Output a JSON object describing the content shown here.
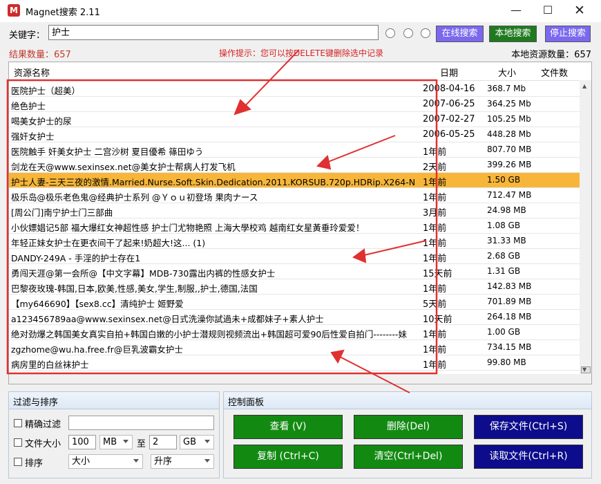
{
  "window": {
    "title": "Magnet搜索 2.11",
    "app_icon_glyph": "M",
    "minimize": "—",
    "maximize": "☐",
    "close": "✕"
  },
  "search": {
    "label": "关键字：",
    "value": "护士",
    "online_button": "在线搜索",
    "local_button": "本地搜索",
    "stop_button": "停止搜索"
  },
  "status": {
    "result_count": "结果数量：657",
    "hint": "操作提示：您可以按DELETE键删除选中记录",
    "local_count": "本地资源数量：657"
  },
  "table": {
    "headers": {
      "name": "资源名称",
      "date": "日期",
      "size": "大小",
      "count": "文件数"
    },
    "rows": [
      {
        "name": "医院护士（超美）",
        "date": "2008-04-16",
        "size": "368.7 Mb"
      },
      {
        "name": "绝色护士",
        "date": "2007-06-25",
        "size": "364.25 Mb"
      },
      {
        "name": "喝美女护士的尿",
        "date": "2007-02-27",
        "size": "105.25 Mb"
      },
      {
        "name": "强奸女护士",
        "date": "2006-05-25",
        "size": "448.28 Mb"
      },
      {
        "name": "医院触手 奸美女护士 二宫沙树 夏目優希 篠田ゆう",
        "date": "1年前",
        "size": "807.70 MB"
      },
      {
        "name": "剑龙在天@www.sexinsex.net@美女护士帮病人打发飞机",
        "date": "2天前",
        "size": "399.26 MB"
      },
      {
        "name": "护士人妻-三天三夜的激情.Married.Nurse.Soft.Skin.Dedication.2011.KORSUB.720p.HDRip.X264-N",
        "date": "1年前",
        "size": "1.50 GB"
      },
      {
        "name": "极乐岛@极乐老色鬼@经典护士系列 @Ｙｏｕ初登场 果肉ナース",
        "date": "1年前",
        "size": "712.47 MB"
      },
      {
        "name": "[周公门]南宁护士门三部曲",
        "date": "3月前",
        "size": "24.98 MB"
      },
      {
        "name": "小伙嫖娼记5部 福大爆红女神超性感 护士门尤物艳照 上海大學校鸡 越南红女星黃垂玲爱爱！",
        "date": "1年前",
        "size": "1.08 GB"
      },
      {
        "name": "年轻正妹女护士在更衣间干了起来!奶超大!这... (1)",
        "date": "1年前",
        "size": "31.33 MB"
      },
      {
        "name": "DANDY-249A - 手淫的护士存在1",
        "date": "1年前",
        "size": "2.68 GB"
      },
      {
        "name": "勇闯天涯@第一会所@【中文字幕】MDB-730露出内裤的性感女护士",
        "date": "15天前",
        "size": "1.31 GB"
      },
      {
        "name": "巴黎夜玫瑰-韩国,日本,欧美,性感,美女,学生,制服,,护士,德国,法国",
        "date": "1年前",
        "size": "142.83 MB"
      },
      {
        "name": "【my646690】【sex8.cc】清纯护士 姬野爱",
        "date": "5天前",
        "size": "701.89 MB"
      },
      {
        "name": "a123456789aa@www.sexinsex.net@日式洗澡你試過未+成都妹子+素人护士",
        "date": "10天前",
        "size": "264.18 MB"
      },
      {
        "name": "绝对劲爆之韩国美女真实自拍+韩国白嫩的小护士潜规则视频流出+韩国超可爱90后性爱自拍门--------妹",
        "date": "1年前",
        "size": "1.00 GB"
      },
      {
        "name": "zgzhome@wu.ha.free.fr@巨乳波霸女护士",
        "date": "1年前",
        "size": "734.15 MB"
      },
      {
        "name": "病房里的白丝袜护士",
        "date": "1年前",
        "size": "99.80 MB"
      }
    ],
    "selected_index": 6,
    "selected_color": "#f7b63a"
  },
  "filter": {
    "title": "过滤与排序",
    "exact_label": "精确过滤",
    "exact_value": "",
    "size_label": "文件大小",
    "size_min": "100",
    "size_min_unit": "MB",
    "size_to": "至",
    "size_max": "2",
    "size_max_unit": "GB",
    "sort_label": "排序",
    "sort_field": "大小",
    "sort_order": "升序"
  },
  "control": {
    "title": "控制面板",
    "view": "查看 (V)",
    "delete": "删除(Del)",
    "save": "保存文件(Ctrl+S)",
    "copy": "复制 (Ctrl+C)",
    "clear": "清空(Ctrl+Del)",
    "load": "读取文件(Ctrl+R)"
  },
  "colors": {
    "online_button": "#7b68ee",
    "local_button": "#1f7a1f",
    "green_button": "#128a12",
    "navy_button": "#0c0c8c",
    "annotation_red": "#e03030"
  }
}
